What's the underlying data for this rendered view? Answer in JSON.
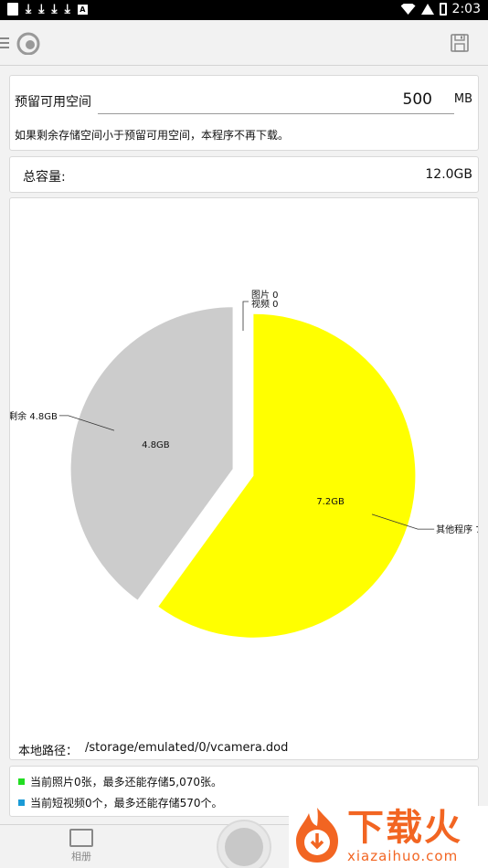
{
  "status_bar": {
    "time": "2:03"
  },
  "reserve": {
    "label": "预留可用空间",
    "value": "500",
    "unit": "MB",
    "hint": "如果剩余存储空间小于预留可用空间，本程序不再下载。"
  },
  "total": {
    "label": "总容量:",
    "value": "12.0GB"
  },
  "chart_data": {
    "type": "pie",
    "slices": [
      {
        "name": "图片 0",
        "value": 0,
        "label": ""
      },
      {
        "name": "视频 0",
        "value": 0,
        "label": ""
      },
      {
        "name": "其他程序 7...",
        "value": 7.2,
        "label": "7.2GB",
        "color": "#ffff00"
      },
      {
        "name": "剩余 4.8GB",
        "value": 4.8,
        "label": "4.8GB",
        "color": "#cccccc"
      }
    ]
  },
  "path": {
    "label": "本地路径：",
    "value": "/storage/emulated/0/vcamera.dod"
  },
  "info": {
    "photo_text": "当前照片0张，最多还能存储5,070张。",
    "photo_color": "#22dd22",
    "video_text": "当前短视频0个，最多还能存储570个。",
    "video_color": "#1a9ad6"
  },
  "bottom_nav": {
    "album_label": "相册"
  },
  "watermark": {
    "brand": "下载火",
    "url": "xiazaihuo.com"
  }
}
